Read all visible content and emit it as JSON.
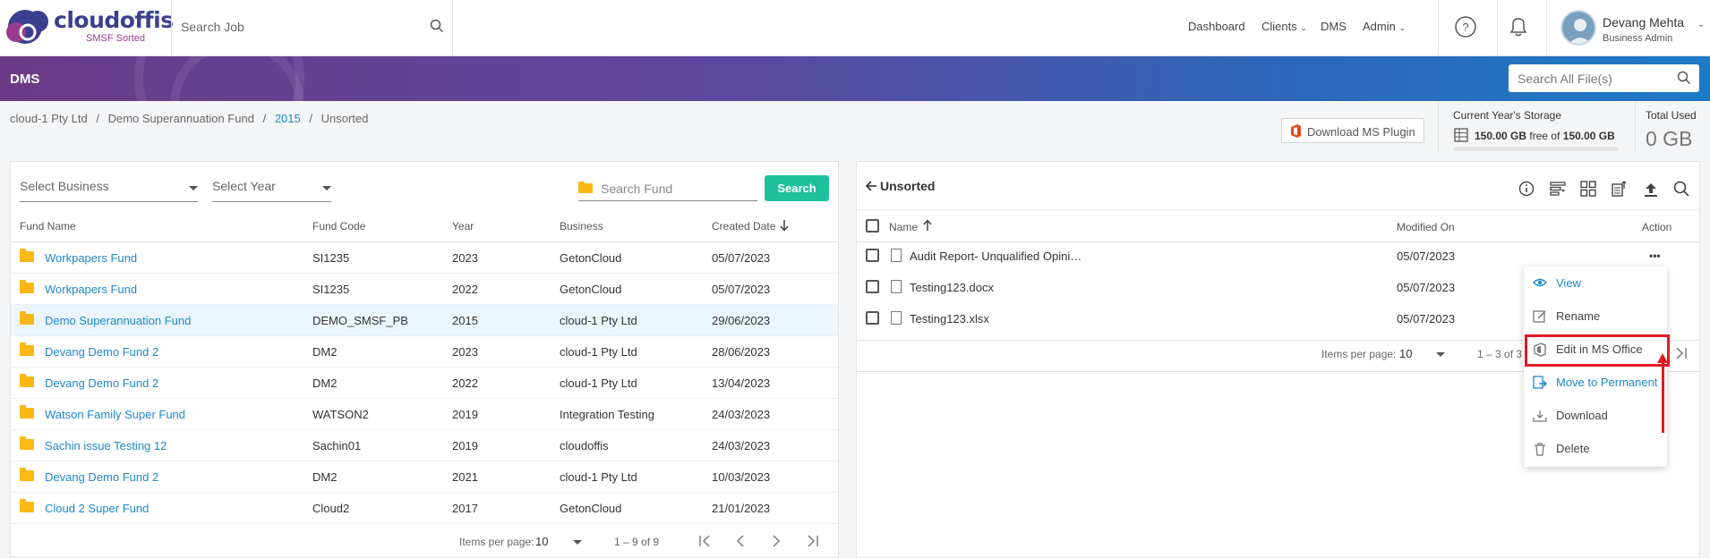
{
  "header": {
    "logo_text": "cloudoffis",
    "logo_subtext": "SMSF Sorted",
    "search_placeholder": "Search Job",
    "nav": {
      "dashboard": "Dashboard",
      "clients": "Clients",
      "dms": "DMS",
      "admin": "Admin"
    },
    "user": {
      "name": "Devang Mehta",
      "role": "Business Admin"
    }
  },
  "banner": {
    "title": "DMS",
    "search_placeholder": "Search All File(s)"
  },
  "breadcrumb": [
    "cloud-1 Pty Ltd",
    "Demo Superannuation Fund",
    "2015",
    "Unsorted"
  ],
  "breadcrumb_sep": "/",
  "plugin_button": "Download MS Plugin",
  "storage": {
    "title": "Current Year's Storage",
    "used": "150.00 GB",
    "free_of": "free of",
    "total": "150.00 GB"
  },
  "total_used": {
    "title": "Total Used",
    "value": "0 GB"
  },
  "left": {
    "select_business": "Select Business",
    "select_year": "Select Year",
    "search_fund_placeholder": "Search Fund",
    "search_button": "Search",
    "columns": [
      "Fund Name",
      "Fund Code",
      "Year",
      "Business",
      "Created Date"
    ],
    "rows": [
      [
        "Workpapers Fund",
        "SI1235",
        "2023",
        "GetonCloud",
        "05/07/2023"
      ],
      [
        "Workpapers Fund",
        "SI1235",
        "2022",
        "GetonCloud",
        "05/07/2023"
      ],
      [
        "Demo Superannuation Fund",
        "DEMO_SMSF_PB",
        "2015",
        "cloud-1 Pty Ltd",
        "29/06/2023"
      ],
      [
        "Devang Demo Fund 2",
        "DM2",
        "2023",
        "cloud-1 Pty Ltd",
        "28/06/2023"
      ],
      [
        "Devang Demo Fund 2",
        "DM2",
        "2022",
        "cloud-1 Pty Ltd",
        "13/04/2023"
      ],
      [
        "Watson Family Super Fund",
        "WATSON2",
        "2019",
        "Integration Testing",
        "24/03/2023"
      ],
      [
        "Sachin issue Testing 12",
        "Sachin01",
        "2019",
        "cloudoffis",
        "24/03/2023"
      ],
      [
        "Devang Demo Fund 2",
        "DM2",
        "2021",
        "cloud-1 Pty Ltd",
        "10/03/2023"
      ],
      [
        "Cloud 2 Super Fund",
        "Cloud2",
        "2017",
        "GetonCloud",
        "21/01/2023"
      ]
    ],
    "pager": {
      "items_label": "Items per page:",
      "items_value": "10",
      "range": "1 – 9 of 9"
    }
  },
  "right": {
    "title": "Unsorted",
    "columns": {
      "name": "Name",
      "modified": "Modified On",
      "action": "Action"
    },
    "files": [
      {
        "name": "Audit Report- Unqualified Opini…",
        "modified": "05/07/2023"
      },
      {
        "name": "Testing123.docx",
        "modified": "05/07/2023"
      },
      {
        "name": "Testing123.xlsx",
        "modified": "05/07/2023"
      }
    ],
    "actions_glyph": "•••",
    "pager": {
      "items_label": "Items per page:",
      "items_value": "10",
      "range": "1 – 3 of 3"
    }
  },
  "context_menu": [
    "View",
    "Rename",
    "Edit in MS Office",
    "Move to Permanent",
    "Download",
    "Delete"
  ],
  "colors": {
    "accent": "#1e87c9",
    "search_button": "#1fc19b",
    "folder": "#fbb714",
    "highlight": "#e01b24"
  }
}
